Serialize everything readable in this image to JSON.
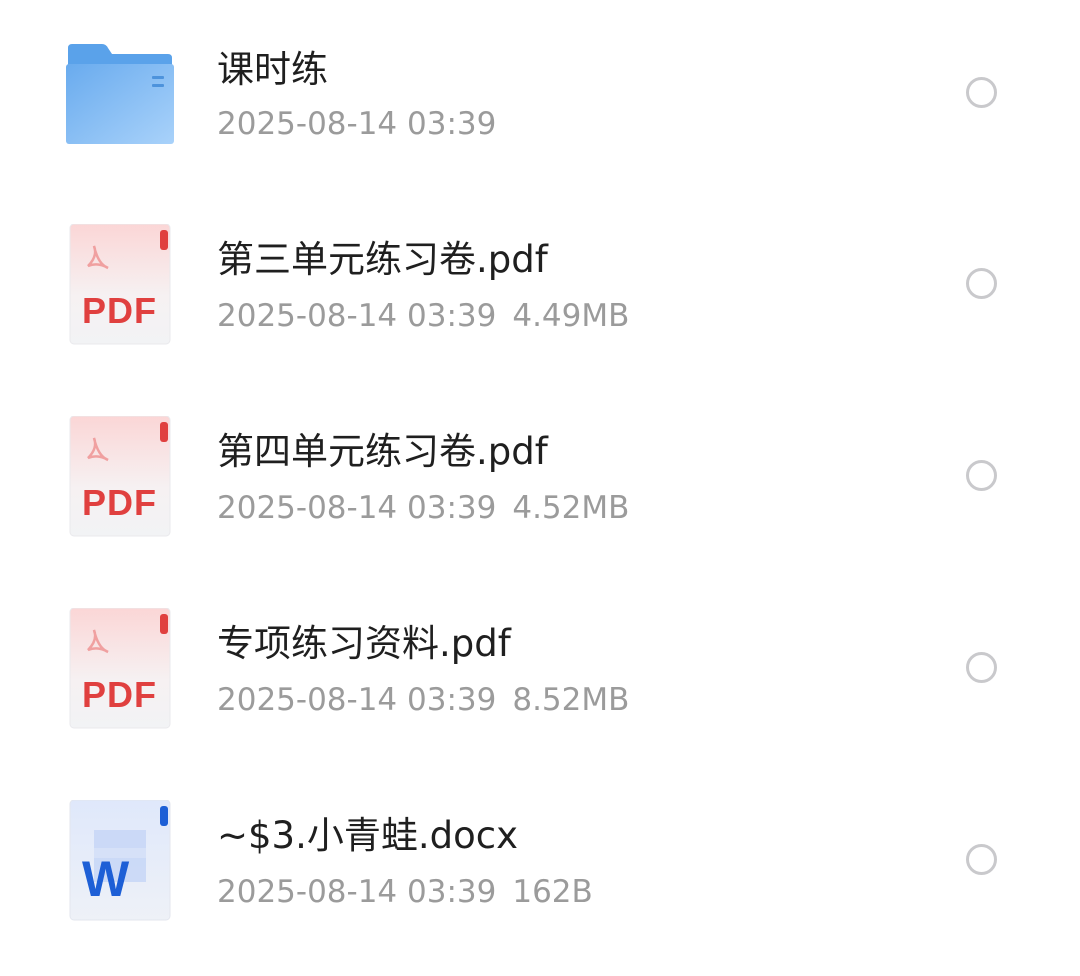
{
  "files": [
    {
      "icon": "folder-icon",
      "name": "课时练",
      "date": "2025-08-14 03:39",
      "size": ""
    },
    {
      "icon": "pdf-file-icon",
      "icon_label": "PDF",
      "name": "第三单元练习卷.pdf",
      "date": "2025-08-14 03:39",
      "size": "4.49MB"
    },
    {
      "icon": "pdf-file-icon",
      "icon_label": "PDF",
      "name": "第四单元练习卷.pdf",
      "date": "2025-08-14 03:39",
      "size": "4.52MB"
    },
    {
      "icon": "pdf-file-icon",
      "icon_label": "PDF",
      "name": "专项练习资料.pdf",
      "date": "2025-08-14 03:39",
      "size": "8.52MB"
    },
    {
      "icon": "word-file-icon",
      "icon_label": "W",
      "name": "~$3.小青蛙.docx",
      "date": "2025-08-14 03:39",
      "size": "162B"
    }
  ],
  "colors": {
    "folder": "#6aaef0",
    "pdf_accent": "#e0403f",
    "word_accent": "#1d5fd6",
    "meta_text": "#9b9b9b",
    "name_text": "#1f1f1f",
    "radio_border": "#c9c9cc"
  }
}
